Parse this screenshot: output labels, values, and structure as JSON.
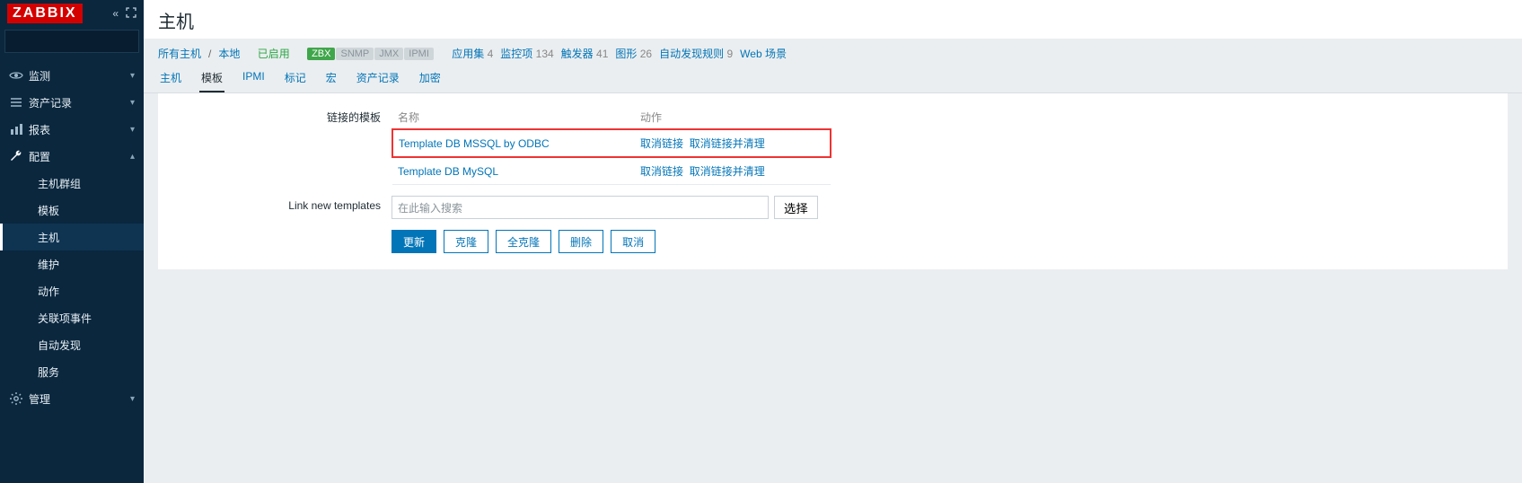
{
  "brand": "ZABBIX",
  "search": {
    "placeholder": ""
  },
  "nav": {
    "monitor": "监测",
    "inventory": "资产记录",
    "reports": "报表",
    "config": "配置",
    "admin": "管理",
    "config_sub": {
      "hostgroups": "主机群组",
      "templates": "模板",
      "hosts": "主机",
      "maintenance": "维护",
      "actions": "动作",
      "correlation": "关联项事件",
      "discovery": "自动发现",
      "services": "服务"
    }
  },
  "page": {
    "title": "主机"
  },
  "infobar": {
    "all_hosts": "所有主机",
    "local": "本地",
    "enabled": "已启用",
    "tags": {
      "zbx": "ZBX",
      "snmp": "SNMP",
      "jmx": "JMX",
      "ipmi": "IPMI"
    },
    "apps_label": "应用集",
    "apps_count": "4",
    "items_label": "监控项",
    "items_count": "134",
    "triggers_label": "触发器",
    "triggers_count": "41",
    "graphs_label": "图形",
    "graphs_count": "26",
    "discovery_label": "自动发现规则",
    "discovery_count": "9",
    "web_label": "Web 场景"
  },
  "tabs": {
    "host": "主机",
    "templates": "模板",
    "ipmi": "IPMI",
    "tags": "标记",
    "macros": "宏",
    "inventory": "资产记录",
    "encryption": "加密"
  },
  "form": {
    "linked_label": "链接的模板",
    "th_name": "名称",
    "th_action": "动作",
    "rows": [
      {
        "name": "Template DB MSSQL by ODBC",
        "unlink": "取消链接",
        "unlink_clear": "取消链接并清理",
        "highlight": true
      },
      {
        "name": "Template DB MySQL",
        "unlink": "取消链接",
        "unlink_clear": "取消链接并清理",
        "highlight": false
      }
    ],
    "link_new_label": "Link new templates",
    "link_new_placeholder": "在此输入搜索",
    "select_btn": "选择"
  },
  "buttons": {
    "update": "更新",
    "clone": "克隆",
    "full_clone": "全克隆",
    "delete": "删除",
    "cancel": "取消"
  }
}
